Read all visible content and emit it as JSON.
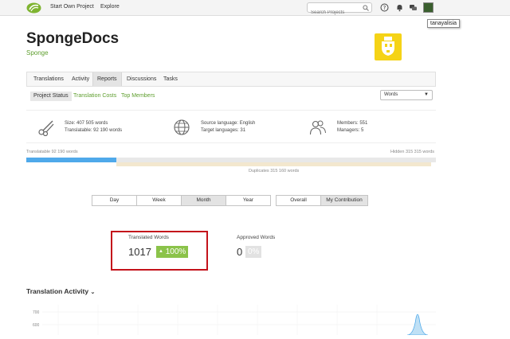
{
  "topbar": {
    "start_project": "Start Own Project",
    "explore": "Explore",
    "search_placeholder": "Search Projects",
    "tooltip_username": "tanayalisia"
  },
  "project": {
    "title": "SpongeDocs",
    "subtitle": "Sponge",
    "logo_color": "#f5d317"
  },
  "tabs": [
    "Translations",
    "Activity",
    "Reports",
    "Discussions",
    "Tasks"
  ],
  "active_tab": "Reports",
  "subtabs": [
    "Project Status",
    "Translation Costs",
    "Top Members"
  ],
  "active_subtab": "Project Status",
  "unit_select": "Words",
  "stats": {
    "size": "Size: 407 505 words",
    "translatable": "Translatable: 92 190 words",
    "source_language": "Source language: English",
    "target_languages": "Target languages: 31",
    "members": "Members: 551",
    "managers": "Managers: 5"
  },
  "progress": {
    "translatable_label": "Translatable 92 190 words",
    "hidden_label": "Hidden 315 315 words",
    "duplicates_label": "Duplicates 315 160 words",
    "fill_fraction": 0.22
  },
  "ranges": [
    "Day",
    "Week",
    "Month",
    "Year"
  ],
  "active_range": "Month",
  "scope": [
    "Overall",
    "My Contribution"
  ],
  "active_scope": "My Contribution",
  "translated": {
    "label": "Translated Words",
    "value": "1017",
    "pct": "100%"
  },
  "approved": {
    "label": "Approved Words",
    "value": "0",
    "pct": "0%"
  },
  "activity": {
    "title": "Translation Activity",
    "y_ticks": [
      "700",
      "600"
    ]
  },
  "colors": {
    "accent_green": "#5e9e2e",
    "badge_green": "#8bc34a",
    "highlight_red": "#c4121b",
    "progress_blue": "#4fa9ea"
  }
}
